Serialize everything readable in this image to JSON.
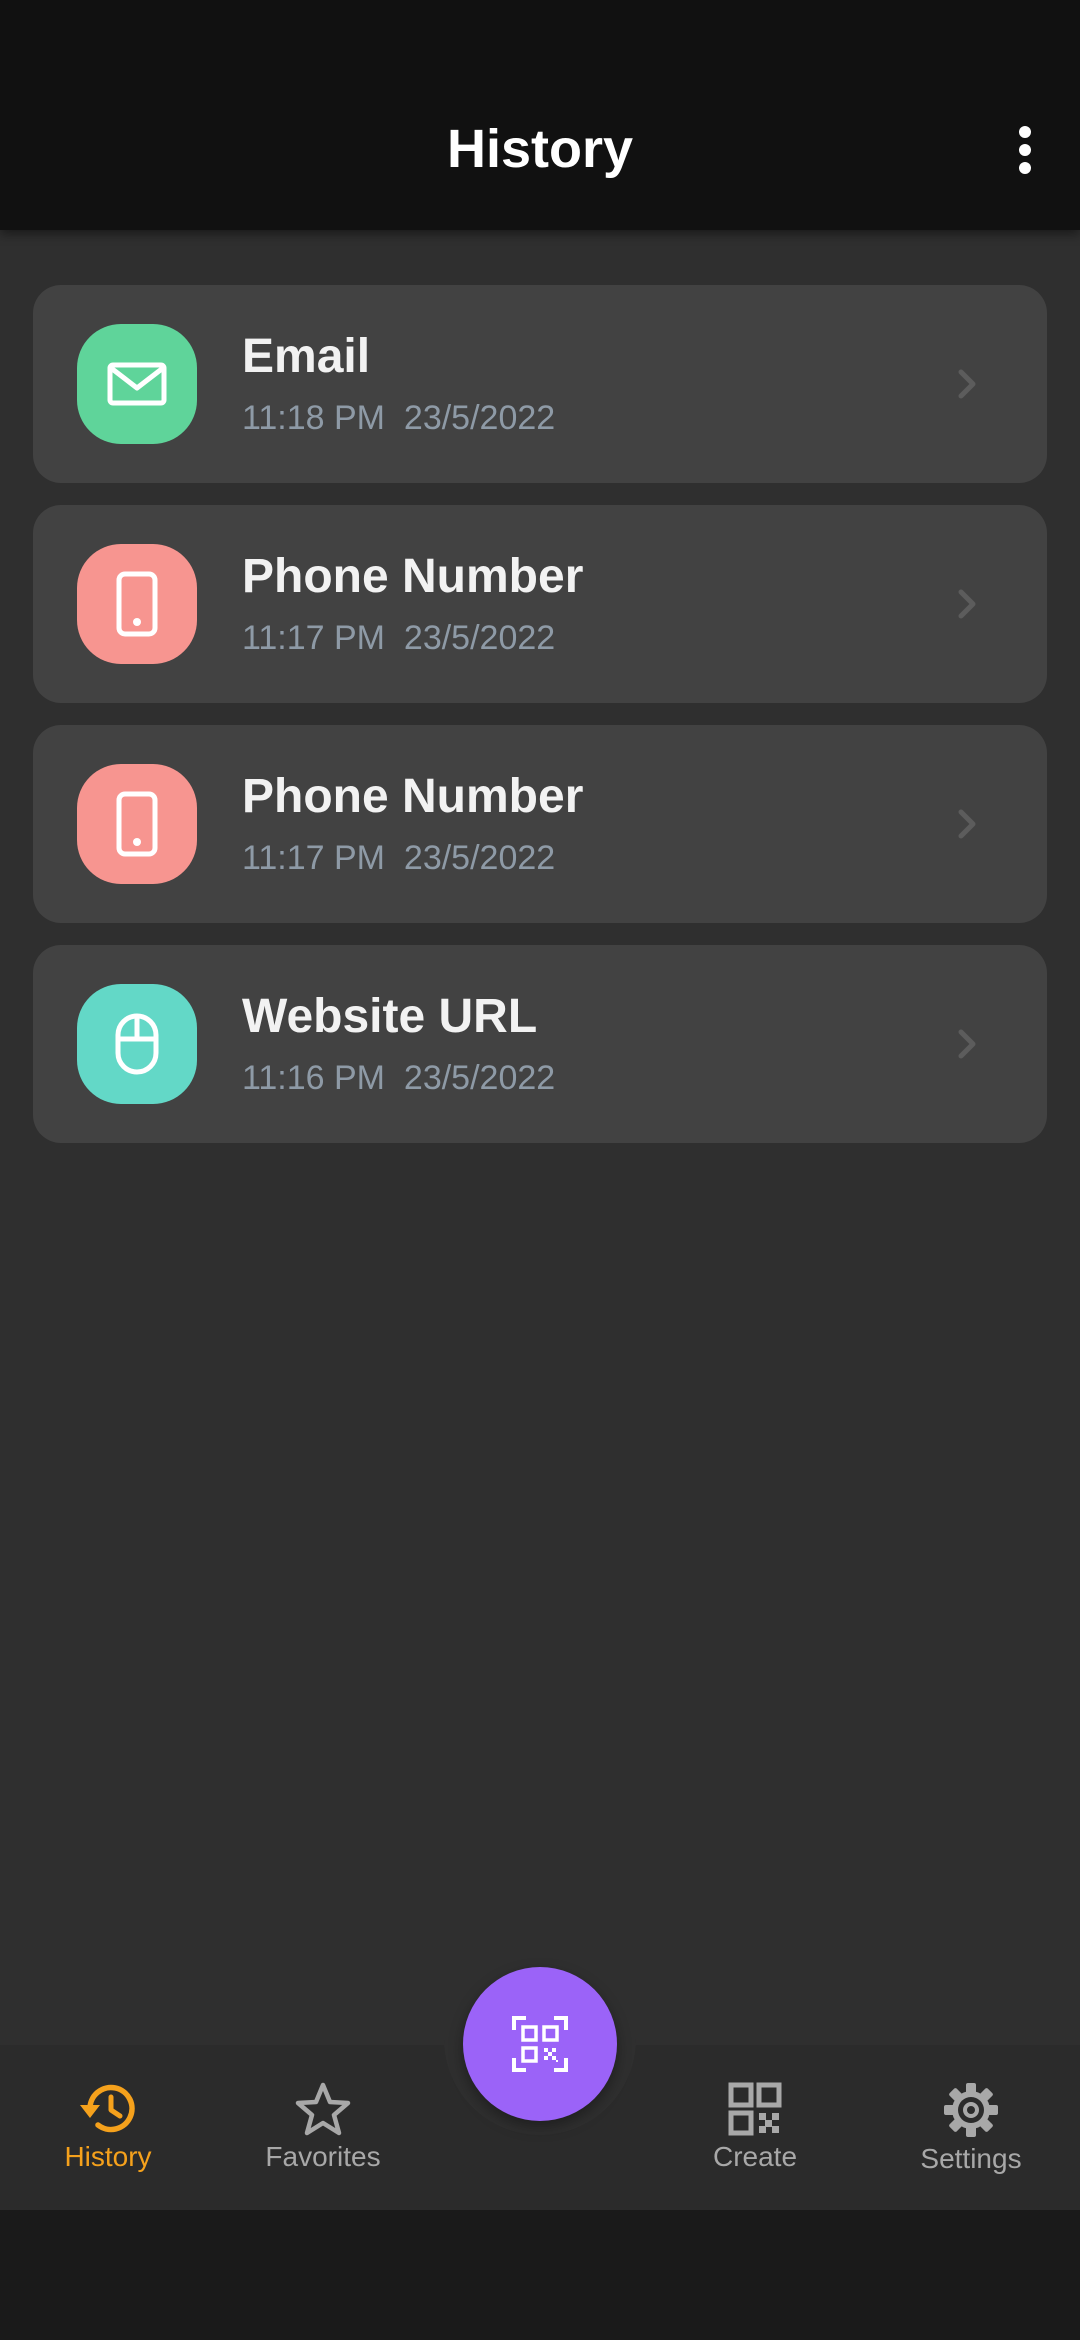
{
  "header": {
    "title": "History"
  },
  "history": [
    {
      "name": "Email",
      "time": "11:18 PM",
      "date": "23/5/2022",
      "icon": "email-icon",
      "color": "#5fd49a"
    },
    {
      "name": "Phone Number",
      "time": "11:17 PM",
      "date": "23/5/2022",
      "icon": "phone-icon",
      "color": "#f79590"
    },
    {
      "name": "Phone Number",
      "time": "11:17 PM",
      "date": "23/5/2022",
      "icon": "phone-icon",
      "color": "#f79590"
    },
    {
      "name": "Website URL",
      "time": "11:16 PM",
      "date": "23/5/2022",
      "icon": "mouse-icon",
      "color": "#63d8c7"
    }
  ],
  "nav": {
    "history": "History",
    "favorites": "Favorites",
    "create": "Create",
    "settings": "Settings",
    "active_color": "#f5a11c",
    "inactive_color": "#a8a8a8"
  },
  "fab": {
    "icon": "qr-scan-icon",
    "color": "#9b63f8"
  }
}
